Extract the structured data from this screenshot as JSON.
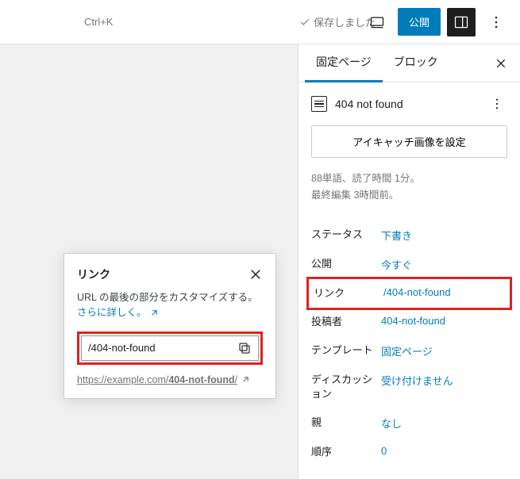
{
  "topbar": {
    "shortcut": "Ctrl+K",
    "saved_label": "保存しました",
    "publish_label": "公開"
  },
  "sidebar": {
    "tabs": {
      "page": "固定ページ",
      "block": "ブロック"
    },
    "title": "404 not found",
    "featured_btn": "アイキャッチ画像を設定",
    "stats_line1": "88単語、読了時間 1分。",
    "stats_line2": "最終編集 3時間前。",
    "rows": {
      "status": {
        "label": "ステータス",
        "value": "下書き"
      },
      "publish": {
        "label": "公開",
        "value": "今すぐ"
      },
      "link": {
        "label": "リンク",
        "value": "/404-not-found"
      },
      "author": {
        "label": "投稿者",
        "value": "404-not-found"
      },
      "template": {
        "label": "テンプレート",
        "value": "固定ページ"
      },
      "discussion": {
        "label": "ディスカッション",
        "value": "受け付けません"
      },
      "parent": {
        "label": "親",
        "value": "なし"
      },
      "order": {
        "label": "順序",
        "value": "0"
      }
    }
  },
  "popover": {
    "title": "リンク",
    "description": "URL の最後の部分をカスタマイズする。",
    "learn_more": "さらに詳しく。",
    "slug": "/404-not-found",
    "permalink_prefix": "https://example.com/",
    "permalink_slug": "404-not-found",
    "permalink_suffix": "/"
  }
}
